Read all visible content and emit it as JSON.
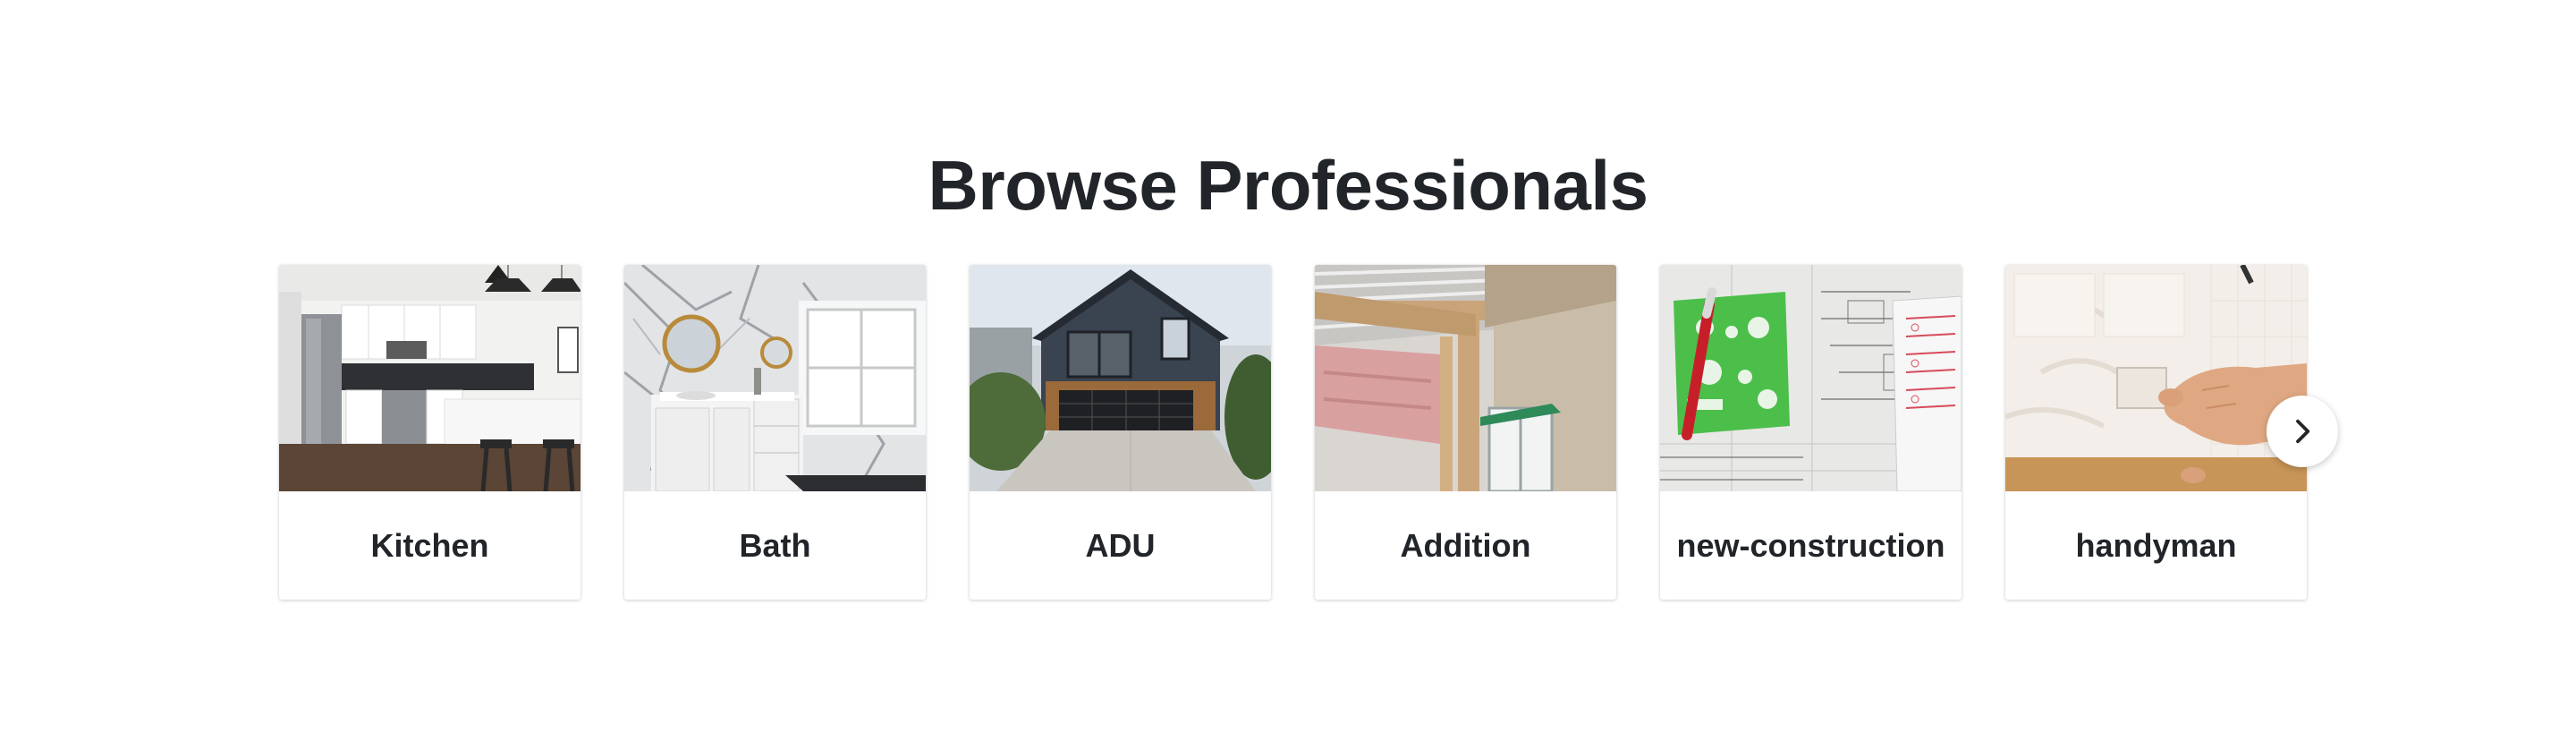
{
  "section": {
    "title": "Browse Professionals"
  },
  "categories": [
    {
      "label": "Kitchen",
      "image": "kitchen-photo"
    },
    {
      "label": "Bath",
      "image": "bathroom-photo"
    },
    {
      "label": "ADU",
      "image": "adu-house-photo"
    },
    {
      "label": "Addition",
      "image": "addition-framing-photo"
    },
    {
      "label": "new-construction",
      "image": "blueprints-photo"
    },
    {
      "label": "handyman",
      "image": "handyman-tile-photo"
    }
  ],
  "carousel": {
    "next_icon": "chevron-right-icon"
  },
  "colors": {
    "text": "#212529",
    "background": "#ffffff"
  }
}
